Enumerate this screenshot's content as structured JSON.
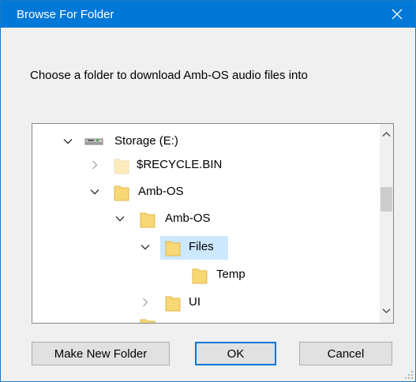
{
  "dialog": {
    "title": "Browse For Folder",
    "prompt": "Choose a folder to download Amb-OS audio files into"
  },
  "tree": {
    "items": [
      {
        "label": "Storage (E:)",
        "icon": "drive-icon",
        "expander": "expanded"
      },
      {
        "label": "$RECYCLE.BIN",
        "icon": "folder-icon",
        "expander": "collapsed",
        "faded": true
      },
      {
        "label": "Amb-OS",
        "icon": "folder-icon",
        "expander": "expanded"
      },
      {
        "label": "Amb-OS",
        "icon": "folder-icon",
        "expander": "expanded"
      },
      {
        "label": "Files",
        "icon": "folder-icon",
        "expander": "expanded",
        "selected": true
      },
      {
        "label": "Temp",
        "icon": "folder-icon",
        "expander": "none"
      },
      {
        "label": "UI",
        "icon": "folder-icon",
        "expander": "collapsed"
      }
    ]
  },
  "buttons": {
    "new_folder": "Make New Folder",
    "ok": "OK",
    "cancel": "Cancel"
  },
  "colors": {
    "titlebar": "#0078d7",
    "selection": "#cce8ff",
    "folder": "#f8d775"
  }
}
